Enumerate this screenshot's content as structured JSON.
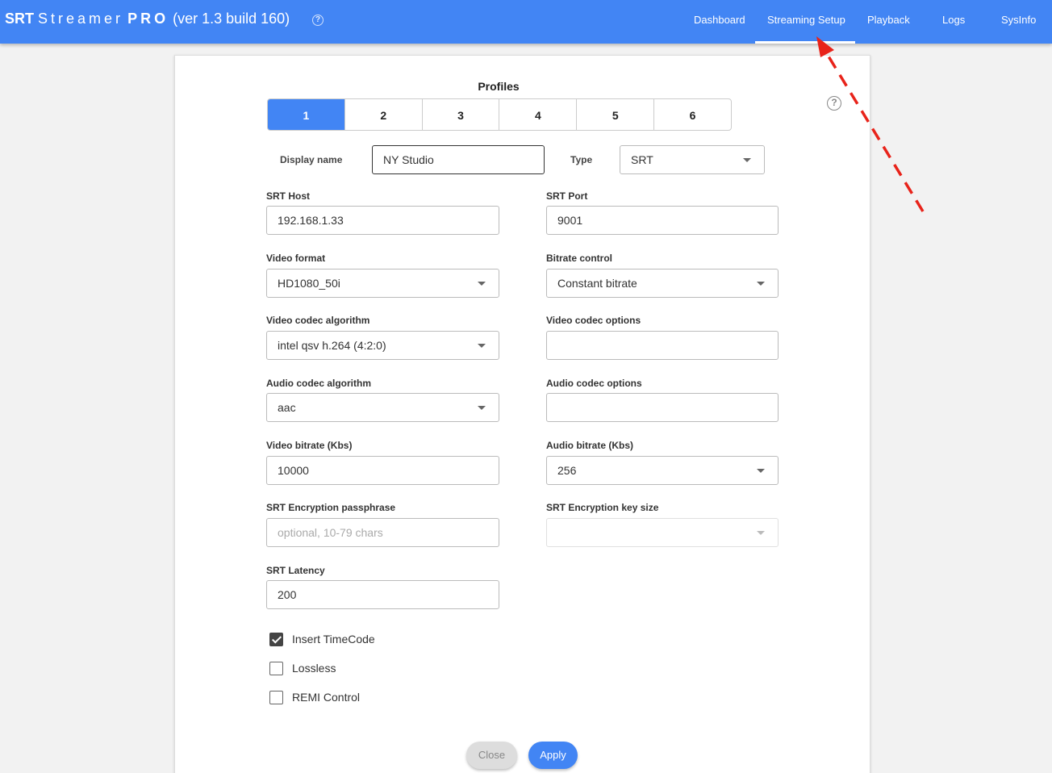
{
  "header": {
    "brand_srt": "SRT",
    "brand_streamer": "Streamer",
    "brand_pro": "PRO",
    "brand_version": "(ver 1.3 build 160)",
    "help_glyph": "?",
    "nav": {
      "dashboard": "Dashboard",
      "streaming_setup": "Streaming Setup",
      "playback": "Playback",
      "logs": "Logs",
      "sysinfo": "SysInfo"
    },
    "active_nav": "Streaming Setup"
  },
  "profiles": {
    "title": "Profiles",
    "tabs": [
      "1",
      "2",
      "3",
      "4",
      "5",
      "6"
    ],
    "active": "1"
  },
  "help_glyph": "?",
  "form": {
    "display_name_label": "Display name",
    "display_name_value": "NY Studio",
    "type_label": "Type",
    "type_value": "SRT",
    "srt_host_label": "SRT Host",
    "srt_host_value": "192.168.1.33",
    "srt_port_label": "SRT Port",
    "srt_port_value": "9001",
    "video_format_label": "Video format",
    "video_format_value": "HD1080_50i",
    "bitrate_control_label": "Bitrate control",
    "bitrate_control_value": "Constant bitrate",
    "video_codec_algorithm_label": "Video codec algorithm",
    "video_codec_algorithm_value": "intel qsv h.264 (4:2:0)",
    "video_codec_options_label": "Video codec options",
    "video_codec_options_value": "",
    "audio_codec_algorithm_label": "Audio codec algorithm",
    "audio_codec_algorithm_value": "aac",
    "audio_codec_options_label": "Audio codec options",
    "audio_codec_options_value": "",
    "video_bitrate_label": "Video bitrate (Kbs)",
    "video_bitrate_value": "10000",
    "audio_bitrate_label": "Audio bitrate (Kbs)",
    "audio_bitrate_value": "256",
    "encryption_passphrase_label": "SRT Encryption passphrase",
    "encryption_passphrase_value": "",
    "encryption_passphrase_placeholder": "optional, 10-79 chars",
    "encryption_key_size_label": "SRT Encryption key size",
    "encryption_key_size_value": "",
    "latency_label": "SRT Latency",
    "latency_value": "200"
  },
  "checkboxes": {
    "insert_timecode": {
      "label": "Insert TimeCode",
      "checked": true
    },
    "lossless": {
      "label": "Lossless",
      "checked": false
    },
    "remi_control": {
      "label": "REMI Control",
      "checked": false
    }
  },
  "buttons": {
    "close": "Close",
    "apply": "Apply"
  },
  "colors": {
    "primary": "#4285f4",
    "annotation_arrow": "#e8231a"
  }
}
